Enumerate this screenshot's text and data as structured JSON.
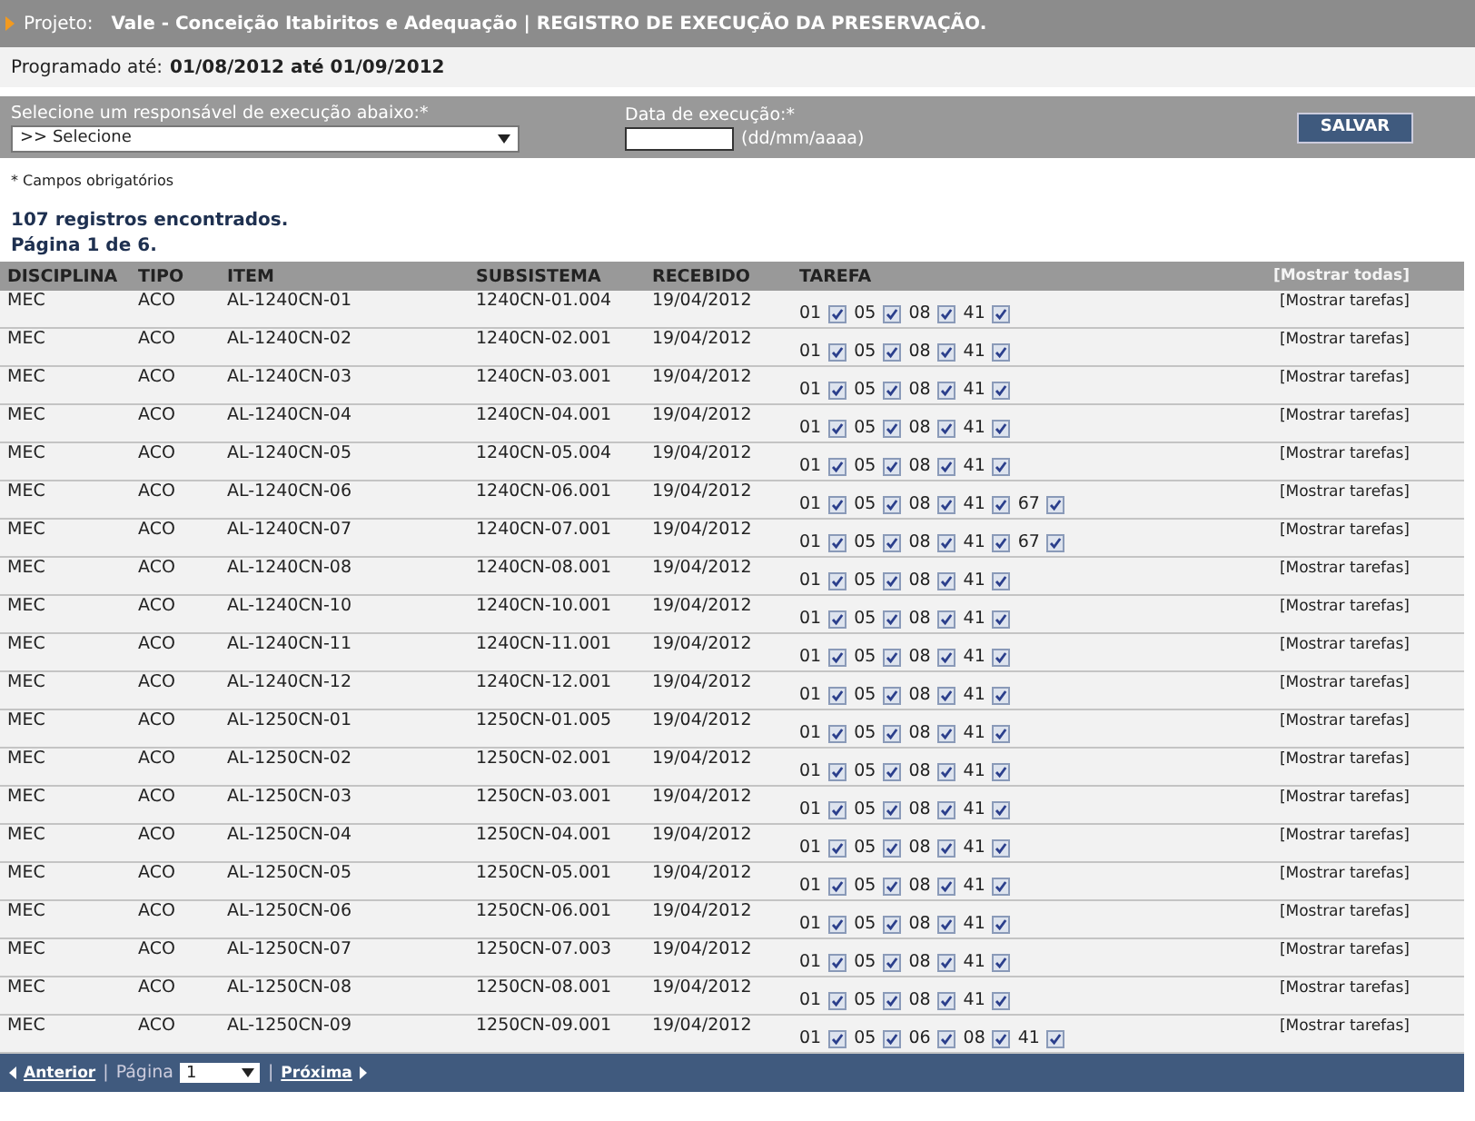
{
  "header": {
    "label": "Projeto:",
    "title": "Vale - Conceição Itabiritos e Adequação | REGISTRO DE EXECUÇÃO DA PRESERVAÇÃO."
  },
  "schedule": {
    "label": "Programado até:",
    "value": "01/08/2012 até 01/09/2012"
  },
  "form": {
    "responsible_label": "Selecione um responsável de execução abaixo:*",
    "responsible_value": ">> Selecione",
    "date_label": "Data de execução:*",
    "date_hint": "(dd/mm/aaaa)",
    "save_button": "SALVAR"
  },
  "required_note": "* Campos obrigatórios",
  "records_count": "107 registros encontrados.",
  "page_info": "Página 1 de 6.",
  "table": {
    "columns": [
      "DISCIPLINA",
      "TIPO",
      "ITEM",
      "SUBSISTEMA",
      "RECEBIDO",
      "TAREFA"
    ],
    "show_all": "[Mostrar todas]",
    "rows": [
      {
        "disciplina": "MEC",
        "tipo": "ACO",
        "item": "AL-1240CN-01",
        "subsistema": "1240CN-01.004",
        "recebido": "19/04/2012",
        "tasks": [
          {
            "code": "01",
            "checked": true
          },
          {
            "code": "05",
            "checked": true
          },
          {
            "code": "08",
            "checked": true
          },
          {
            "code": "41",
            "checked": true
          }
        ],
        "action": "[Mostrar tarefas]"
      },
      {
        "disciplina": "MEC",
        "tipo": "ACO",
        "item": "AL-1240CN-02",
        "subsistema": "1240CN-02.001",
        "recebido": "19/04/2012",
        "tasks": [
          {
            "code": "01",
            "checked": true
          },
          {
            "code": "05",
            "checked": true
          },
          {
            "code": "08",
            "checked": true
          },
          {
            "code": "41",
            "checked": true
          }
        ],
        "action": "[Mostrar tarefas]"
      },
      {
        "disciplina": "MEC",
        "tipo": "ACO",
        "item": "AL-1240CN-03",
        "subsistema": "1240CN-03.001",
        "recebido": "19/04/2012",
        "tasks": [
          {
            "code": "01",
            "checked": true
          },
          {
            "code": "05",
            "checked": true
          },
          {
            "code": "08",
            "checked": true
          },
          {
            "code": "41",
            "checked": true
          }
        ],
        "action": "[Mostrar tarefas]"
      },
      {
        "disciplina": "MEC",
        "tipo": "ACO",
        "item": "AL-1240CN-04",
        "subsistema": "1240CN-04.001",
        "recebido": "19/04/2012",
        "tasks": [
          {
            "code": "01",
            "checked": true
          },
          {
            "code": "05",
            "checked": true
          },
          {
            "code": "08",
            "checked": true
          },
          {
            "code": "41",
            "checked": true
          }
        ],
        "action": "[Mostrar tarefas]"
      },
      {
        "disciplina": "MEC",
        "tipo": "ACO",
        "item": "AL-1240CN-05",
        "subsistema": "1240CN-05.004",
        "recebido": "19/04/2012",
        "tasks": [
          {
            "code": "01",
            "checked": true
          },
          {
            "code": "05",
            "checked": true
          },
          {
            "code": "08",
            "checked": true
          },
          {
            "code": "41",
            "checked": true
          }
        ],
        "action": "[Mostrar tarefas]"
      },
      {
        "disciplina": "MEC",
        "tipo": "ACO",
        "item": "AL-1240CN-06",
        "subsistema": "1240CN-06.001",
        "recebido": "19/04/2012",
        "tasks": [
          {
            "code": "01",
            "checked": true
          },
          {
            "code": "05",
            "checked": true
          },
          {
            "code": "08",
            "checked": true
          },
          {
            "code": "41",
            "checked": true
          },
          {
            "code": "67",
            "checked": true
          }
        ],
        "action": "[Mostrar tarefas]"
      },
      {
        "disciplina": "MEC",
        "tipo": "ACO",
        "item": "AL-1240CN-07",
        "subsistema": "1240CN-07.001",
        "recebido": "19/04/2012",
        "tasks": [
          {
            "code": "01",
            "checked": true
          },
          {
            "code": "05",
            "checked": true
          },
          {
            "code": "08",
            "checked": true
          },
          {
            "code": "41",
            "checked": true
          },
          {
            "code": "67",
            "checked": true
          }
        ],
        "action": "[Mostrar tarefas]"
      },
      {
        "disciplina": "MEC",
        "tipo": "ACO",
        "item": "AL-1240CN-08",
        "subsistema": "1240CN-08.001",
        "recebido": "19/04/2012",
        "tasks": [
          {
            "code": "01",
            "checked": true
          },
          {
            "code": "05",
            "checked": true
          },
          {
            "code": "08",
            "checked": true
          },
          {
            "code": "41",
            "checked": true
          }
        ],
        "action": "[Mostrar tarefas]"
      },
      {
        "disciplina": "MEC",
        "tipo": "ACO",
        "item": "AL-1240CN-10",
        "subsistema": "1240CN-10.001",
        "recebido": "19/04/2012",
        "tasks": [
          {
            "code": "01",
            "checked": true
          },
          {
            "code": "05",
            "checked": true
          },
          {
            "code": "08",
            "checked": true
          },
          {
            "code": "41",
            "checked": true
          }
        ],
        "action": "[Mostrar tarefas]"
      },
      {
        "disciplina": "MEC",
        "tipo": "ACO",
        "item": "AL-1240CN-11",
        "subsistema": "1240CN-11.001",
        "recebido": "19/04/2012",
        "tasks": [
          {
            "code": "01",
            "checked": true
          },
          {
            "code": "05",
            "checked": true
          },
          {
            "code": "08",
            "checked": true
          },
          {
            "code": "41",
            "checked": true
          }
        ],
        "action": "[Mostrar tarefas]"
      },
      {
        "disciplina": "MEC",
        "tipo": "ACO",
        "item": "AL-1240CN-12",
        "subsistema": "1240CN-12.001",
        "recebido": "19/04/2012",
        "tasks": [
          {
            "code": "01",
            "checked": true
          },
          {
            "code": "05",
            "checked": true
          },
          {
            "code": "08",
            "checked": true
          },
          {
            "code": "41",
            "checked": true
          }
        ],
        "action": "[Mostrar tarefas]"
      },
      {
        "disciplina": "MEC",
        "tipo": "ACO",
        "item": "AL-1250CN-01",
        "subsistema": "1250CN-01.005",
        "recebido": "19/04/2012",
        "tasks": [
          {
            "code": "01",
            "checked": true
          },
          {
            "code": "05",
            "checked": true
          },
          {
            "code": "08",
            "checked": true
          },
          {
            "code": "41",
            "checked": true
          }
        ],
        "action": "[Mostrar tarefas]"
      },
      {
        "disciplina": "MEC",
        "tipo": "ACO",
        "item": "AL-1250CN-02",
        "subsistema": "1250CN-02.001",
        "recebido": "19/04/2012",
        "tasks": [
          {
            "code": "01",
            "checked": true
          },
          {
            "code": "05",
            "checked": true
          },
          {
            "code": "08",
            "checked": true
          },
          {
            "code": "41",
            "checked": true
          }
        ],
        "action": "[Mostrar tarefas]"
      },
      {
        "disciplina": "MEC",
        "tipo": "ACO",
        "item": "AL-1250CN-03",
        "subsistema": "1250CN-03.001",
        "recebido": "19/04/2012",
        "tasks": [
          {
            "code": "01",
            "checked": true
          },
          {
            "code": "05",
            "checked": true
          },
          {
            "code": "08",
            "checked": true
          },
          {
            "code": "41",
            "checked": true
          }
        ],
        "action": "[Mostrar tarefas]"
      },
      {
        "disciplina": "MEC",
        "tipo": "ACO",
        "item": "AL-1250CN-04",
        "subsistema": "1250CN-04.001",
        "recebido": "19/04/2012",
        "tasks": [
          {
            "code": "01",
            "checked": true
          },
          {
            "code": "05",
            "checked": true
          },
          {
            "code": "08",
            "checked": true
          },
          {
            "code": "41",
            "checked": true
          }
        ],
        "action": "[Mostrar tarefas]"
      },
      {
        "disciplina": "MEC",
        "tipo": "ACO",
        "item": "AL-1250CN-05",
        "subsistema": "1250CN-05.001",
        "recebido": "19/04/2012",
        "tasks": [
          {
            "code": "01",
            "checked": true
          },
          {
            "code": "05",
            "checked": true
          },
          {
            "code": "08",
            "checked": true
          },
          {
            "code": "41",
            "checked": true
          }
        ],
        "action": "[Mostrar tarefas]"
      },
      {
        "disciplina": "MEC",
        "tipo": "ACO",
        "item": "AL-1250CN-06",
        "subsistema": "1250CN-06.001",
        "recebido": "19/04/2012",
        "tasks": [
          {
            "code": "01",
            "checked": true
          },
          {
            "code": "05",
            "checked": true
          },
          {
            "code": "08",
            "checked": true
          },
          {
            "code": "41",
            "checked": true
          }
        ],
        "action": "[Mostrar tarefas]"
      },
      {
        "disciplina": "MEC",
        "tipo": "ACO",
        "item": "AL-1250CN-07",
        "subsistema": "1250CN-07.003",
        "recebido": "19/04/2012",
        "tasks": [
          {
            "code": "01",
            "checked": true
          },
          {
            "code": "05",
            "checked": true
          },
          {
            "code": "08",
            "checked": true
          },
          {
            "code": "41",
            "checked": true
          }
        ],
        "action": "[Mostrar tarefas]"
      },
      {
        "disciplina": "MEC",
        "tipo": "ACO",
        "item": "AL-1250CN-08",
        "subsistema": "1250CN-08.001",
        "recebido": "19/04/2012",
        "tasks": [
          {
            "code": "01",
            "checked": true
          },
          {
            "code": "05",
            "checked": true
          },
          {
            "code": "08",
            "checked": true
          },
          {
            "code": "41",
            "checked": true
          }
        ],
        "action": "[Mostrar tarefas]"
      },
      {
        "disciplina": "MEC",
        "tipo": "ACO",
        "item": "AL-1250CN-09",
        "subsistema": "1250CN-09.001",
        "recebido": "19/04/2012",
        "tasks": [
          {
            "code": "01",
            "checked": true
          },
          {
            "code": "05",
            "checked": true
          },
          {
            "code": "06",
            "checked": true
          },
          {
            "code": "08",
            "checked": true
          },
          {
            "code": "41",
            "checked": true
          }
        ],
        "action": "[Mostrar tarefas]"
      }
    ]
  },
  "pagination": {
    "previous": "Anterior",
    "separator_1": "|",
    "page_label": "Página",
    "page_value": "1",
    "separator_2": "|",
    "next": "Próxima"
  }
}
